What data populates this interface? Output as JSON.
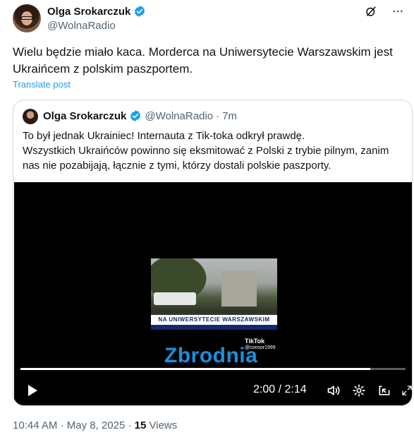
{
  "author": {
    "name": "Olga Srokarczuk",
    "handle": "@WolnaRadio"
  },
  "tweet": {
    "text": "Wielu będzie miało kaca. Morderca na Uniwersytecie Warszawskim jest Ukraińcem z polskim paszportem.",
    "translate_label": "Translate post"
  },
  "quote": {
    "name": "Olga Srokarczuk",
    "handle": "@WolnaRadio",
    "separator": "·",
    "time": "7m",
    "text_line1": "To był jednak Ukrainiec! Internauta z Tik-toka odkrył prawdę.",
    "text_line2": "Wszystkich Ukraińców powinno się eksmitować z Polski z trybie pilnym, zanim nas nie pozabijają, łącznie z tymi, którzy dostali polskie paszporty."
  },
  "video": {
    "banner_text": "NA UNIWERSYTECIE WARSZAWSKIM",
    "tiktok_brand": "TikTok",
    "tiktok_user": "@consor1999",
    "caption": "Zbrodnia",
    "current_time": "2:00",
    "total_time": "2:14",
    "progress": 0.909
  },
  "footer": {
    "time": "10:44 AM",
    "sep1": "·",
    "date": "May 8, 2025",
    "sep2": "·",
    "views_count": "15",
    "views_label": "Views"
  },
  "colors": {
    "link": "#1d9bf0",
    "verified": "#1d9bf0",
    "caption": "#1c8fde"
  }
}
